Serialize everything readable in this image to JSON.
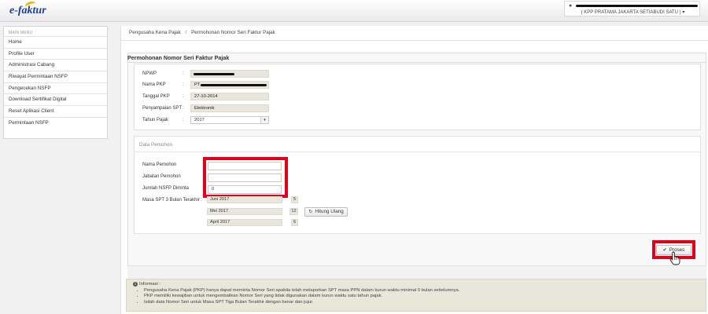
{
  "app": {
    "logo_text": "e-faktur"
  },
  "user": {
    "office": "( KPP PRATAMA JAKARTA SETIABUDI SATU )",
    "caret": "▾"
  },
  "sidebar": {
    "title": "MAIN MENU",
    "items": [
      {
        "label": "Home"
      },
      {
        "label": "Profile User"
      },
      {
        "label": "Administrasi Cabang"
      },
      {
        "label": "Riwayat Permintaan NSFP"
      },
      {
        "label": "Pengecekan NSFP"
      },
      {
        "label": "Download Sertifikat Digital"
      },
      {
        "label": "Reset Aplikasi Client"
      },
      {
        "label": "Permintaan NSFP"
      }
    ]
  },
  "breadcrumb": {
    "parent": "Pengusaha Kena Pajak",
    "separator": "/",
    "current": "Permohonan Nomor Seri Faktur Pajak"
  },
  "panel": {
    "title": "Permohonan Nomor Seri Faktur Pajak"
  },
  "form": {
    "colon": ":",
    "npwp": {
      "label": "NPWP"
    },
    "nama_pkp": {
      "label": "Nama PKP",
      "value_prefix": "PT."
    },
    "tanggal_pkp": {
      "label": "Tanggal PKP",
      "value": "27-10-2014"
    },
    "penyampaian_spt": {
      "label": "Penyampaian SPT",
      "value": "Elektronik"
    },
    "tahun_pajak": {
      "label": "Tahun Pajak",
      "value": "2017",
      "arrow": "▾"
    }
  },
  "pemohon": {
    "section_title": "Data Pemohon",
    "nama": {
      "label": "Nama Pemohon",
      "value": ""
    },
    "jabatan": {
      "label": "Jabatan Pemohon",
      "value": ""
    },
    "jumlah": {
      "label": "Jumlah NSFP Diminta",
      "value": "0"
    },
    "masa": {
      "label": "Masa SPT 3 Bulan Terakhir",
      "rows": [
        {
          "period": "Juni 2017",
          "count": "5"
        },
        {
          "period": "Mei 2017",
          "count": "12"
        },
        {
          "period": "April 2017",
          "count": "6"
        }
      ]
    },
    "hitung_label": "Hitung Ulang",
    "hitung_icon": "↻"
  },
  "actions": {
    "proses_label": "Proses",
    "proses_icon": "✔"
  },
  "info": {
    "title": "Informasi :",
    "icon": "i",
    "items": [
      "Pengusaha Kena Pajak (PKP) hanya dapat meminta Nomor Seri apabila telah melaporkan SPT masa PPN dalam kurun waktu minimal 0 bulan sebelumnya.",
      "PKP memiliki kewajiban untuk mengembalikan Nomor Seri yang tidak digunakan dalam kurun waktu satu tahun pajak.",
      "Isilah data Nomor Seri untuk Masa SPT Tiga Bulan Terakhir dengan benar dan jujur."
    ]
  },
  "colors": {
    "highlight": "#e2001a",
    "brand": "#1d3f8f",
    "accent": "#f2b31c"
  }
}
